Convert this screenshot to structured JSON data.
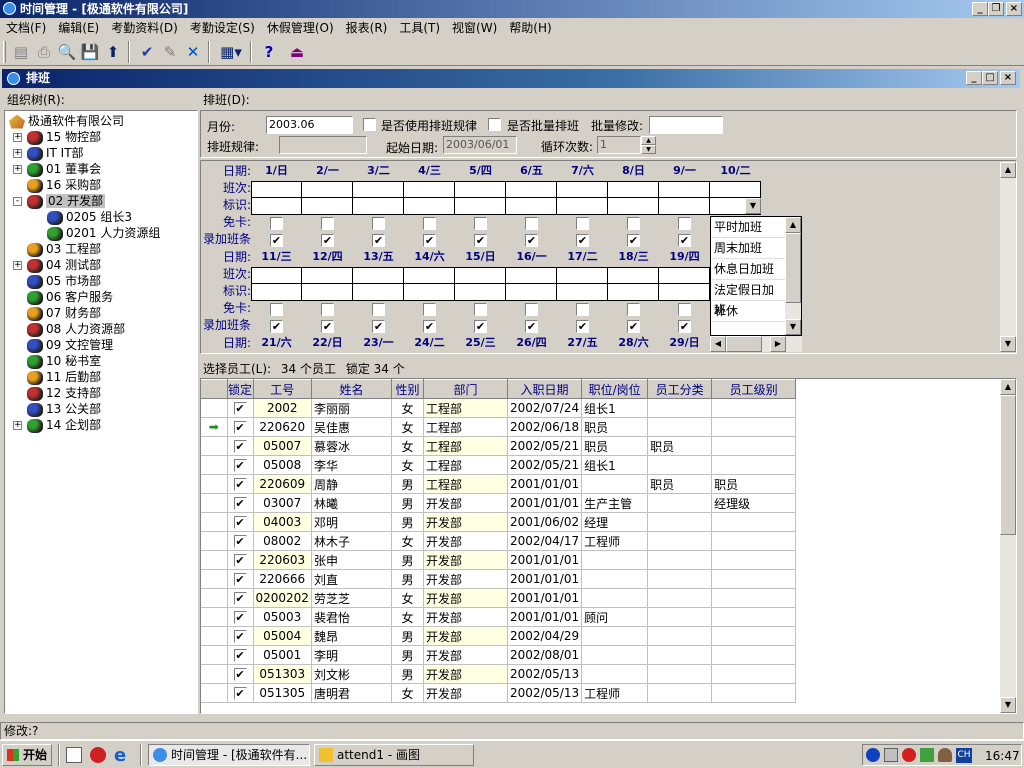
{
  "window": {
    "title": "时间管理 - [极通软件有限公司]",
    "subtitle": "排班"
  },
  "menu": [
    "文档(F)",
    "编辑(E)",
    "考勤资料(D)",
    "考勤设定(S)",
    "休假管理(O)",
    "报表(R)",
    "工具(T)",
    "视窗(W)",
    "帮助(H)"
  ],
  "left": {
    "label": "组织树(R):",
    "tree": [
      {
        "label": "极通软件有限公司",
        "level": 0,
        "expander": "",
        "icon": "company-icon"
      },
      {
        "label": "15  物控部",
        "level": 1,
        "expander": "+"
      },
      {
        "label": "IT  IT部",
        "level": 1,
        "expander": "+"
      },
      {
        "label": "01  董事会",
        "level": 1,
        "expander": "+"
      },
      {
        "label": "16  采购部",
        "level": 1,
        "expander": ""
      },
      {
        "label": "02  开发部",
        "level": 1,
        "expander": "-",
        "selected": true
      },
      {
        "label": "0205  组长3",
        "level": 2,
        "expander": ""
      },
      {
        "label": "0201  人力资源组",
        "level": 2,
        "expander": ""
      },
      {
        "label": "03  工程部",
        "level": 1,
        "expander": ""
      },
      {
        "label": "04  测试部",
        "level": 1,
        "expander": "+"
      },
      {
        "label": "05  市场部",
        "level": 1,
        "expander": ""
      },
      {
        "label": "06  客户服务",
        "level": 1,
        "expander": ""
      },
      {
        "label": "07  财务部",
        "level": 1,
        "expander": ""
      },
      {
        "label": "08  人力资源部",
        "level": 1,
        "expander": ""
      },
      {
        "label": "09  文控管理",
        "level": 1,
        "expander": ""
      },
      {
        "label": "10  秘书室",
        "level": 1,
        "expander": ""
      },
      {
        "label": "11  后勤部",
        "level": 1,
        "expander": ""
      },
      {
        "label": "12  支持部",
        "level": 1,
        "expander": ""
      },
      {
        "label": "13  公关部",
        "level": 1,
        "expander": ""
      },
      {
        "label": "14  企划部",
        "level": 1,
        "expander": "+"
      }
    ]
  },
  "schedule": {
    "label": "排班(D):",
    "month_label": "月份:",
    "month_value": "2003.06",
    "use_rule_label": "是否使用排班规律",
    "batch_label": "是否批量排班",
    "batch_modify_label": "批量修改:",
    "batch_modify_value": "",
    "rule_label": "排班规律:",
    "rule_value": "",
    "start_date_label": "起始日期:",
    "start_date_value": "2003/06/01",
    "cycle_label": "循环次数:",
    "cycle_value": "1",
    "row_labels": [
      "日期:",
      "班次:",
      "标识:",
      "免卡:",
      "录加班条"
    ],
    "weeks": [
      [
        "1/日",
        "2/一",
        "3/二",
        "4/三",
        "5/四",
        "6/五",
        "7/六",
        "8/日",
        "9/一",
        "10/二"
      ],
      [
        "11/三",
        "12/四",
        "13/五",
        "14/六",
        "15/日",
        "16/一",
        "17/二",
        "18/三",
        "19/四",
        ""
      ],
      [
        "21/六",
        "22/日",
        "23/一",
        "24/二",
        "25/三",
        "26/四",
        "27/五",
        "28/六",
        "29/日",
        ""
      ]
    ],
    "dropdown_options": [
      "平时加班",
      "周末加班",
      "休息日加班",
      "法定假日加班",
      "补休"
    ]
  },
  "employees": {
    "label": "选择员工(L):",
    "count_text": "34 个员工",
    "lock_text": "锁定 34 个",
    "columns": [
      "锁定",
      "工号",
      "姓名",
      "性别",
      "部门",
      "入职日期",
      "职位/岗位",
      "员工分类",
      "员工级别"
    ],
    "rows": [
      [
        "2002",
        "李丽丽",
        "女",
        "工程部",
        "2002/07/24",
        "组长1",
        "",
        ""
      ],
      [
        "220620",
        "吴佳惠",
        "女",
        "工程部",
        "2002/06/18",
        "职员",
        "",
        ""
      ],
      [
        "05007",
        "慕蓉冰",
        "女",
        "工程部",
        "2002/05/21",
        "职员",
        "职员",
        ""
      ],
      [
        "05008",
        "李华",
        "女",
        "工程部",
        "2002/05/21",
        "组长1",
        "",
        ""
      ],
      [
        "220609",
        "周静",
        "男",
        "工程部",
        "2001/01/01",
        "",
        "职员",
        "职员"
      ],
      [
        "03007",
        "林曦",
        "男",
        "开发部",
        "2001/01/01",
        "生产主管",
        "",
        "经理级"
      ],
      [
        "04003",
        "邓明",
        "男",
        "开发部",
        "2001/06/02",
        "经理",
        "",
        ""
      ],
      [
        "08002",
        "林木子",
        "女",
        "开发部",
        "2002/04/17",
        "工程师",
        "",
        ""
      ],
      [
        "220603",
        "张申",
        "男",
        "开发部",
        "2001/01/01",
        "",
        "",
        ""
      ],
      [
        "220666",
        "刘直",
        "男",
        "开发部",
        "2001/01/01",
        "",
        "",
        ""
      ],
      [
        "0200202",
        "劳芝芝",
        "女",
        "开发部",
        "2001/01/01",
        "",
        "",
        ""
      ],
      [
        "05003",
        "裴君怡",
        "女",
        "开发部",
        "2001/01/01",
        "顾问",
        "",
        ""
      ],
      [
        "05004",
        "魏昂",
        "男",
        "开发部",
        "2002/04/29",
        "",
        "",
        ""
      ],
      [
        "05001",
        "李明",
        "男",
        "开发部",
        "2002/08/01",
        "",
        "",
        ""
      ],
      [
        "051303",
        "刘文彬",
        "男",
        "开发部",
        "2002/05/13",
        "",
        "",
        ""
      ],
      [
        "051305",
        "唐明君",
        "女",
        "开发部",
        "2002/05/13",
        "工程师",
        "",
        ""
      ]
    ]
  },
  "status": {
    "text": "修改:?"
  },
  "taskbar": {
    "start": "开始",
    "tasks": [
      "时间管理 - [极通软件有...",
      "attend1 - 画图"
    ],
    "clock": "16:47",
    "ime": "CH"
  },
  "colors": {
    "title_dark": "#0a246a",
    "title_light": "#a6caf0",
    "row_alt": "#ffffe1",
    "header_text": "#000080"
  }
}
